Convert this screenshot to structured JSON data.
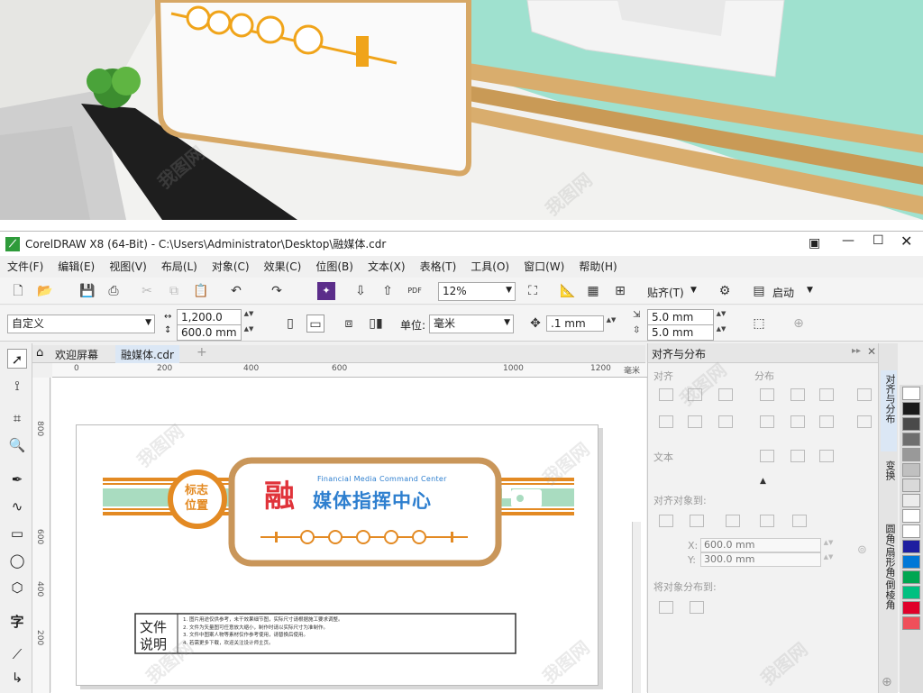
{
  "window": {
    "title": "CorelDRAW X8 (64-Bit) - C:\\Users\\Administrator\\Desktop\\融媒体.cdr"
  },
  "menu": [
    "文件(F)",
    "编辑(E)",
    "视图(V)",
    "布局(L)",
    "对象(C)",
    "效果(C)",
    "位图(B)",
    "文本(X)",
    "表格(T)",
    "工具(O)",
    "窗口(W)",
    "帮助(H)"
  ],
  "toolbar": {
    "zoom_value": "12%",
    "snap_label": "贴齐(T)",
    "launch_label": "启动"
  },
  "propbar": {
    "page_preset": "自定义",
    "width": "1,200.0 mm",
    "height": "600.0 mm",
    "unit_label": "单位:",
    "unit_value": "毫米",
    "nudge": ".1 mm",
    "dup_x": "5.0 mm",
    "dup_y": "5.0 mm"
  },
  "tabs": {
    "welcome": "欢迎屏幕",
    "document": "融媒体.cdr",
    "add": "+"
  },
  "ruler": {
    "h_ticks": [
      "0",
      "200",
      "400",
      "600",
      "1000",
      "1200"
    ],
    "h_unit": "毫米",
    "v_ticks": [
      "800",
      "600",
      "400",
      "200"
    ]
  },
  "design": {
    "badge_line1": "标志",
    "badge_line2": "位置",
    "big_char": "融",
    "title": "媒体指挥中心",
    "subtitle": "Financial Media Command Center",
    "note_heading_1": "文件",
    "note_heading_2": "说明",
    "note_lines": [
      "1. 图片用途仅供参考，未干效果细节图，实际尺寸请根据施工要求调整。",
      "2. 文件为矢量图可任意放大缩小，制作时请以实际尺寸为准制作。",
      "3. 文件中图案人物等素材仅作参考使用，请替换后使用。",
      "4. 若需更多下载，欢迎关注设计师主页。"
    ],
    "colors": {
      "orange": "#e38a23",
      "green": "#a9dcc0",
      "brown_border": "#c9965a",
      "title_blue": "#2e7fcf",
      "big_char_red": "#e0333a"
    }
  },
  "docker": {
    "panel_title": "对齐与分布",
    "align_label": "对齐",
    "distribute_label": "分布",
    "text_label": "文本",
    "align_to_label": "对齐对象到:",
    "x_value": "600.0 mm",
    "y_value": "300.0 mm",
    "distribute_to_label": "将对象分布到:",
    "x_prefix": "X:",
    "y_prefix": "Y:"
  },
  "side_tabs": [
    "对齐与分布",
    "变换",
    "圆角/扇形角/倒棱角"
  ],
  "palette_colors": [
    "#ffffff",
    "#1a1a1a",
    "#4a4a4a",
    "#6e6e6e",
    "#999999",
    "#c0c0c0",
    "#d9d9d9",
    "#ececec",
    "#ffffff",
    "#ffffff",
    "#1e1ea0",
    "#0078d7",
    "#00a651",
    "#00c080",
    "#e0002a",
    "#f04f5a"
  ]
}
